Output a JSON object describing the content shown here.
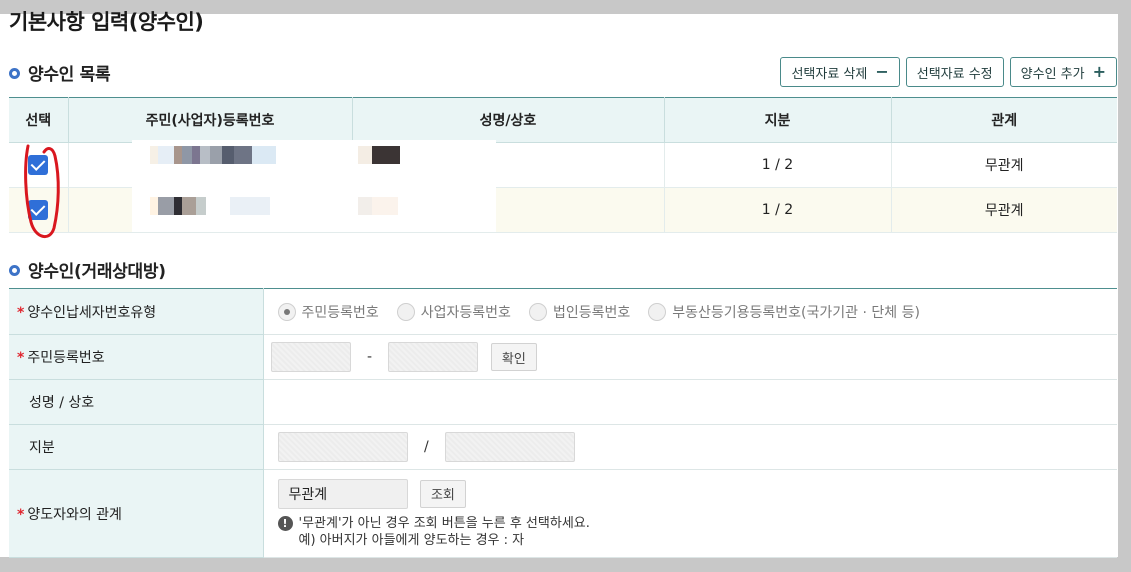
{
  "page_title": "기본사항 입력(양수인)",
  "list_section": {
    "title": "양수인 목록",
    "buttons": {
      "delete_label": "선택자료 삭제",
      "delete_symbol": "−",
      "edit_label": "선택자료 수정",
      "add_label": "양수인 추가",
      "add_symbol": "+"
    },
    "columns": [
      "선택",
      "주민(사업자)등록번호",
      "성명/상호",
      "지분",
      "관계"
    ],
    "rows": [
      {
        "checked": true,
        "share": "1 / 2",
        "relation": "무관계"
      },
      {
        "checked": true,
        "share": "1 / 2",
        "relation": "무관계"
      }
    ]
  },
  "form_section": {
    "title": "양수인(거래상대방)",
    "taxpayer_type": {
      "label": "양수인납세자번호유형",
      "options": [
        "주민등록번호",
        "사업자등록번호",
        "법인등록번호",
        "부동산등기용등록번호(국가기관 · 단체 등)"
      ],
      "selected_index": 0
    },
    "resident_number": {
      "label": "주민등록번호",
      "separator": "-",
      "confirm_label": "확인"
    },
    "name": {
      "label": "성명 / 상호"
    },
    "share": {
      "label": "지분",
      "separator": "/"
    },
    "relation": {
      "label": "양도자와의 관계",
      "value": "무관계",
      "lookup_label": "조회",
      "notice_line1": "'무관계'가 아닌 경우 조회 버튼을 누른 후 선택하세요.",
      "notice_line2": "예) 아버지가 아들에게 양도하는 경우 : 자"
    }
  },
  "colors": {
    "accent": "#3d73c7",
    "header_bg": "#eaf5f5",
    "checkbox": "#2f6fd8",
    "required": "#e0262f",
    "annotation": "#d9171f"
  }
}
